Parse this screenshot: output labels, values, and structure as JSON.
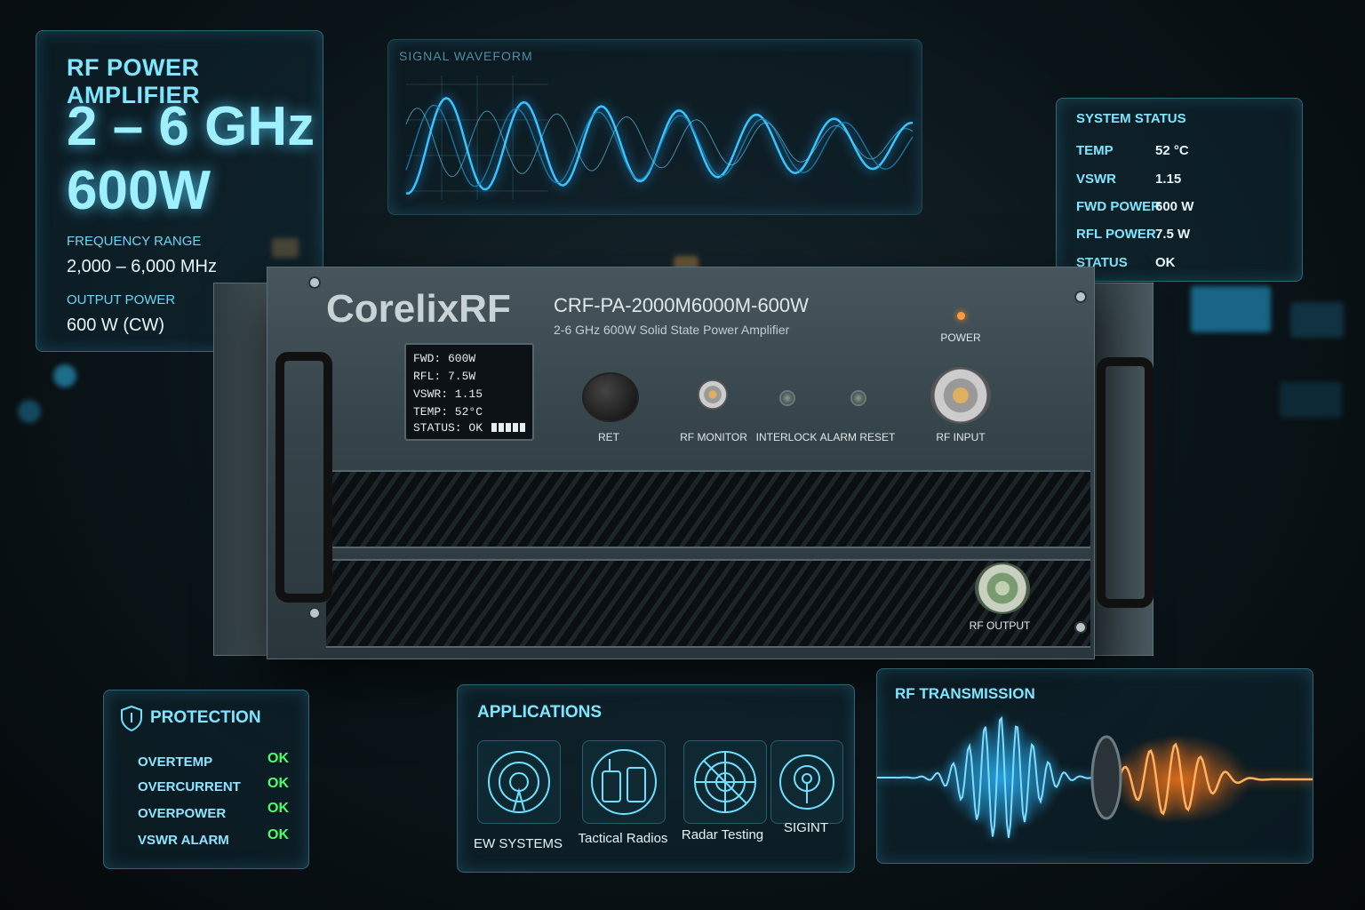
{
  "spec": {
    "title": "RF POWER AMPLIFIER",
    "band": "2 – 6 GHz",
    "power": "600W",
    "freq_label": "FREQUENCY RANGE",
    "freq_value": "2,000 – 6,000 MHz",
    "out_label": "OUTPUT POWER",
    "out_value": "600 W (CW)"
  },
  "waveform": {
    "title": "SIGNAL WAVEFORM"
  },
  "system_status": {
    "title": "SYSTEM STATUS",
    "rows": [
      {
        "key": "TEMP",
        "value": "52 °C"
      },
      {
        "key": "VSWR",
        "value": "1.15"
      },
      {
        "key": "FWD POWER",
        "value": "600 W"
      },
      {
        "key": "RFL POWER",
        "value": "7.5 W"
      },
      {
        "key": "STATUS",
        "value": "OK"
      }
    ]
  },
  "device": {
    "brand": "CorelixRF",
    "model": "CRF-PA-2000M6000M-600W",
    "subtitle": "2-6 GHz 600W Solid State Power Amplifier",
    "lcd": {
      "fwd": "FWD:  600W",
      "rfl": "RFL:  7.5W",
      "vswr": "VSWR: 1.15",
      "temp": "TEMP:  52°C",
      "status": "STATUS: OK"
    },
    "labels": {
      "ret": "RET",
      "rf_monitor": "RF MONITOR",
      "interlock": "INTERLOCK",
      "alarm_reset": "ALARM RESET",
      "rf_input": "RF INPUT",
      "power": "POWER",
      "rf_output": "RF OUTPUT"
    }
  },
  "protection": {
    "title": "PROTECTION",
    "rows": [
      {
        "name": "OVERTEMP",
        "status": "OK"
      },
      {
        "name": "OVERCURRENT",
        "status": "OK"
      },
      {
        "name": "OVERPOWER",
        "status": "OK"
      },
      {
        "name": "VSWR ALARM",
        "status": "OK"
      }
    ]
  },
  "applications": {
    "title": "APPLICATIONS",
    "items": [
      {
        "label": "EW SYSTEMS",
        "icon": "antenna-icon"
      },
      {
        "label": "Tactical Radios",
        "icon": "radio-icon"
      },
      {
        "label": "Radar Testing",
        "icon": "radar-icon"
      },
      {
        "label": "SIGINT",
        "icon": "signal-icon"
      }
    ]
  },
  "transmission": {
    "title": "RF TRANSMISSION"
  },
  "colors": {
    "accent": "#6fe0ff",
    "ok": "#4cff6a",
    "chassis": "#3a484e",
    "beam_blue": "#2ab8ff",
    "beam_orange": "#ff7a1a"
  }
}
